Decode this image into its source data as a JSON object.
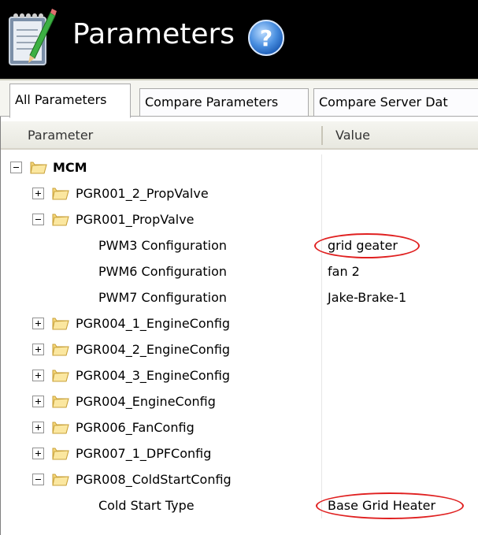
{
  "header": {
    "title": "Parameters",
    "background": "#000000",
    "icon": "notepad-pencil-icon",
    "help_icon": "help-icon"
  },
  "tabs": [
    {
      "label": "All Parameters",
      "active": true
    },
    {
      "label": "Compare Parameters",
      "active": false
    },
    {
      "label": "Compare Server Dat",
      "active": false
    }
  ],
  "grid": {
    "columns": [
      "Parameter",
      "Value"
    ],
    "rows": [
      {
        "label": "MCM",
        "level": 0,
        "type": "group",
        "expanded": true,
        "value": ""
      },
      {
        "label": "PGR001_2_PropValve",
        "level": 1,
        "type": "group",
        "expanded": false,
        "value": ""
      },
      {
        "label": "PGR001_PropValve",
        "level": 1,
        "type": "group",
        "expanded": true,
        "value": ""
      },
      {
        "label": "PWM3 Configuration",
        "level": 2,
        "type": "param",
        "value": "grid geater",
        "highlighted": true
      },
      {
        "label": "PWM6 Configuration",
        "level": 2,
        "type": "param",
        "value": "fan 2"
      },
      {
        "label": "PWM7 Configuration",
        "level": 2,
        "type": "param",
        "value": "Jake-Brake-1"
      },
      {
        "label": "PGR004_1_EngineConfig",
        "level": 1,
        "type": "group",
        "expanded": false,
        "value": ""
      },
      {
        "label": "PGR004_2_EngineConfig",
        "level": 1,
        "type": "group",
        "expanded": false,
        "value": ""
      },
      {
        "label": "PGR004_3_EngineConfig",
        "level": 1,
        "type": "group",
        "expanded": false,
        "value": ""
      },
      {
        "label": "PGR004_EngineConfig",
        "level": 1,
        "type": "group",
        "expanded": false,
        "value": ""
      },
      {
        "label": "PGR006_FanConfig",
        "level": 1,
        "type": "group",
        "expanded": false,
        "value": ""
      },
      {
        "label": "PGR007_1_DPFConfig",
        "level": 1,
        "type": "group",
        "expanded": false,
        "value": ""
      },
      {
        "label": "PGR008_ColdStartConfig",
        "level": 1,
        "type": "group",
        "expanded": true,
        "value": ""
      },
      {
        "label": "Cold Start Type",
        "level": 2,
        "type": "param",
        "value": "Base Grid Heater",
        "highlighted": true
      }
    ]
  },
  "colors": {
    "highlight_ellipse": "#e02020",
    "folder": "#f5d67a"
  }
}
